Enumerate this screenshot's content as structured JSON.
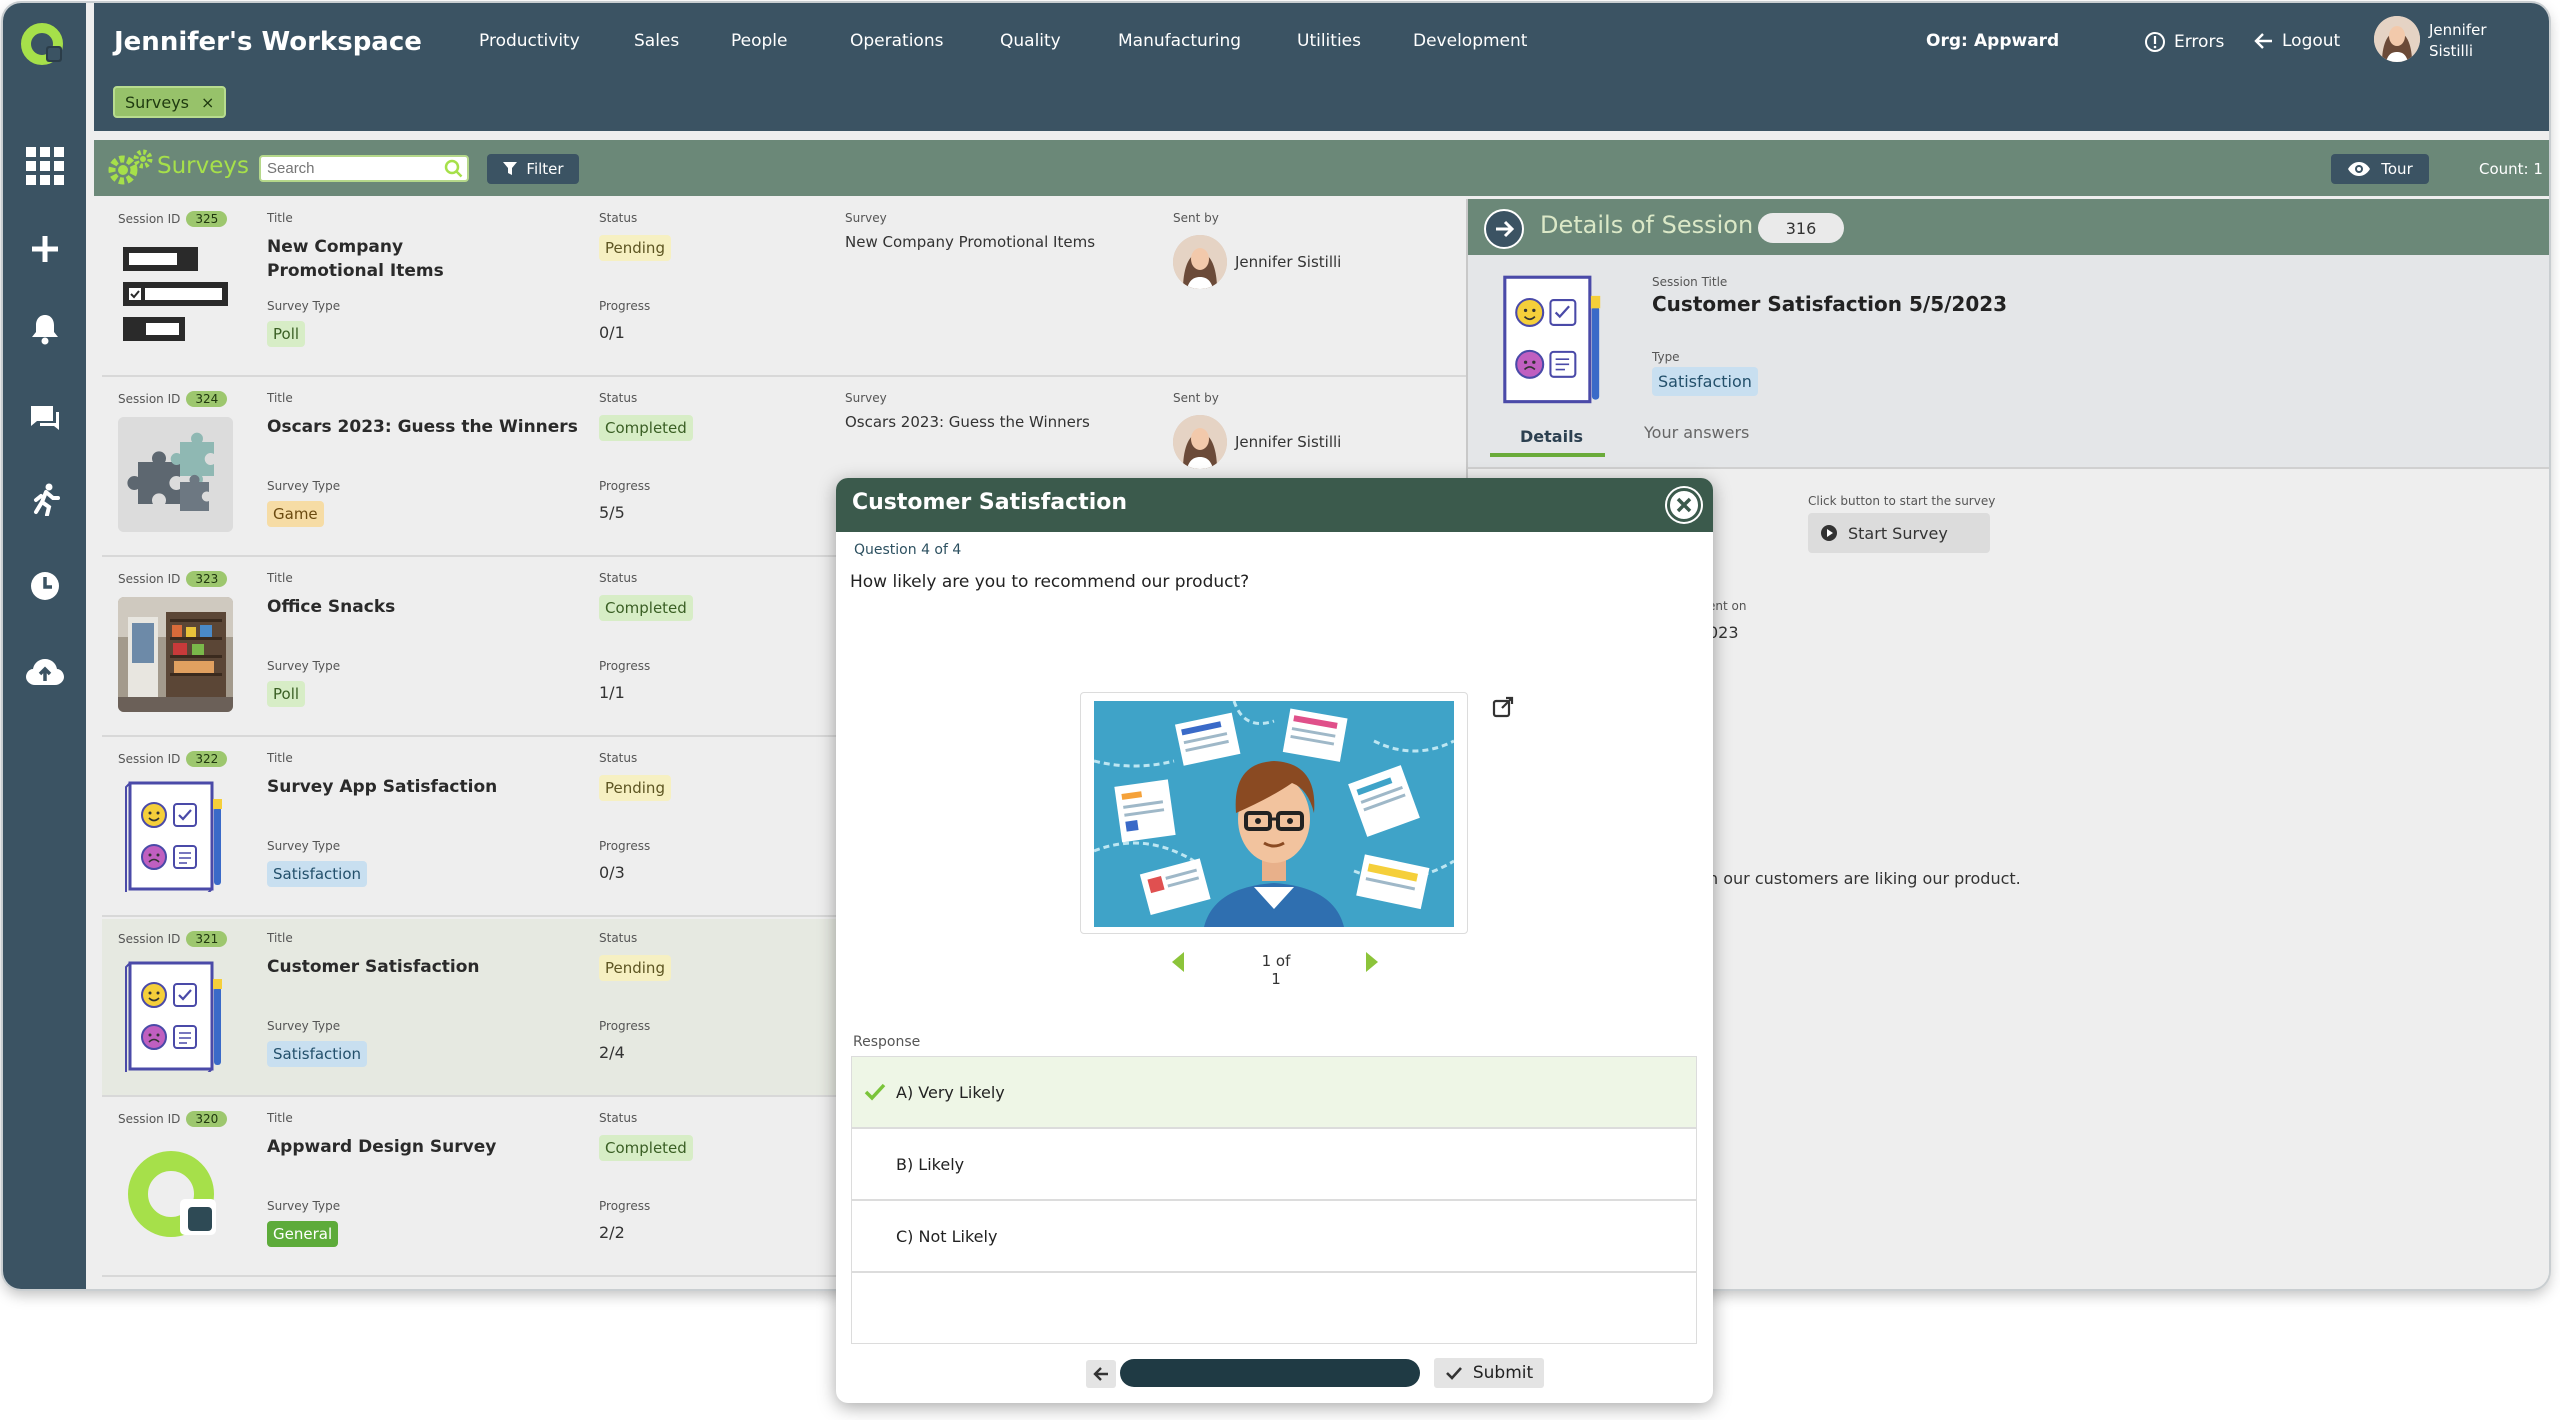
{
  "workspace": {
    "title": "Jennifer's Workspace"
  },
  "nav": [
    "Productivity",
    "Sales",
    "People",
    "Operations",
    "Quality",
    "Manufacturing",
    "Utilities",
    "Development"
  ],
  "org": {
    "label": "Org:",
    "value": "Appward"
  },
  "top_links": {
    "errors": "Errors",
    "logout": "Logout"
  },
  "user": {
    "line1": "Jennifer",
    "line2": "Sistilli"
  },
  "tab_chip": {
    "label": "Surveys",
    "close": "×"
  },
  "toolbar": {
    "title": "Surveys",
    "search_placeholder": "Search",
    "filter": "Filter",
    "tour": "Tour",
    "count": "Count: 1"
  },
  "labels": {
    "session_id": "Session ID",
    "title": "Title",
    "status": "Status",
    "survey": "Survey",
    "sent_by": "Sent by",
    "survey_type": "Survey Type",
    "progress": "Progress"
  },
  "sessions": [
    {
      "id": "325",
      "title": "New Company Promotional Items",
      "status": "Pending",
      "survey": "New Company Promotional Items",
      "sent_by": "Jennifer Sistilli",
      "type": "Poll",
      "progress": "0/1",
      "thumb": "poll-icon"
    },
    {
      "id": "324",
      "title": "Oscars 2023: Guess the Winners",
      "status": "Completed",
      "survey": "Oscars 2023: Guess the Winners",
      "sent_by": "Jennifer Sistilli",
      "type": "Game",
      "progress": "5/5",
      "thumb": "puzzle-icon"
    },
    {
      "id": "323",
      "title": "Office Snacks",
      "status": "Completed",
      "survey": "",
      "sent_by": "",
      "type": "Poll",
      "progress": "1/1",
      "thumb": "snacks-photo"
    },
    {
      "id": "322",
      "title": "Survey App Satisfaction",
      "status": "Pending",
      "survey": "",
      "sent_by": "",
      "type": "Satisfaction",
      "progress": "0/3",
      "thumb": "satisfaction-icon"
    },
    {
      "id": "321",
      "title": "Customer Satisfaction",
      "status": "Pending",
      "survey": "",
      "sent_by": "",
      "type": "Satisfaction",
      "progress": "2/4",
      "thumb": "satisfaction-icon"
    },
    {
      "id": "320",
      "title": "Appward Design Survey",
      "status": "Completed",
      "survey": "",
      "sent_by": "",
      "type": "General",
      "progress": "2/2",
      "thumb": "appward-logo"
    }
  ],
  "details": {
    "header": "Details of Session",
    "session_number": "316",
    "session_title_label": "Session Title",
    "session_title": "Customer Satisfaction 5/5/2023",
    "type_label": "Type",
    "type": "Satisfaction",
    "tab_details": "Details",
    "tab_answers": "Your answers",
    "start_hint": "Click button to start the survey",
    "start_button": "Start Survey",
    "sent_on_fragment": "ent on",
    "date_fragment": "023",
    "description_fragment": "h our customers are liking our product."
  },
  "modal": {
    "title": "Customer Satisfaction",
    "question_counter": "Question 4 of 4",
    "question": "How likely are you to recommend our product?",
    "image_pager": "1 of 1",
    "response_label": "Response",
    "responses": [
      {
        "label": "A) Very Likely",
        "selected": true
      },
      {
        "label": "B) Likely",
        "selected": false
      },
      {
        "label": "C) Not Likely",
        "selected": false
      }
    ],
    "submit": "Submit"
  },
  "colors": {
    "sidebar": "#3b5363",
    "toolbar": "#6b8878",
    "accent_green": "#a6e04a",
    "modal_header": "#3b5a4c"
  }
}
